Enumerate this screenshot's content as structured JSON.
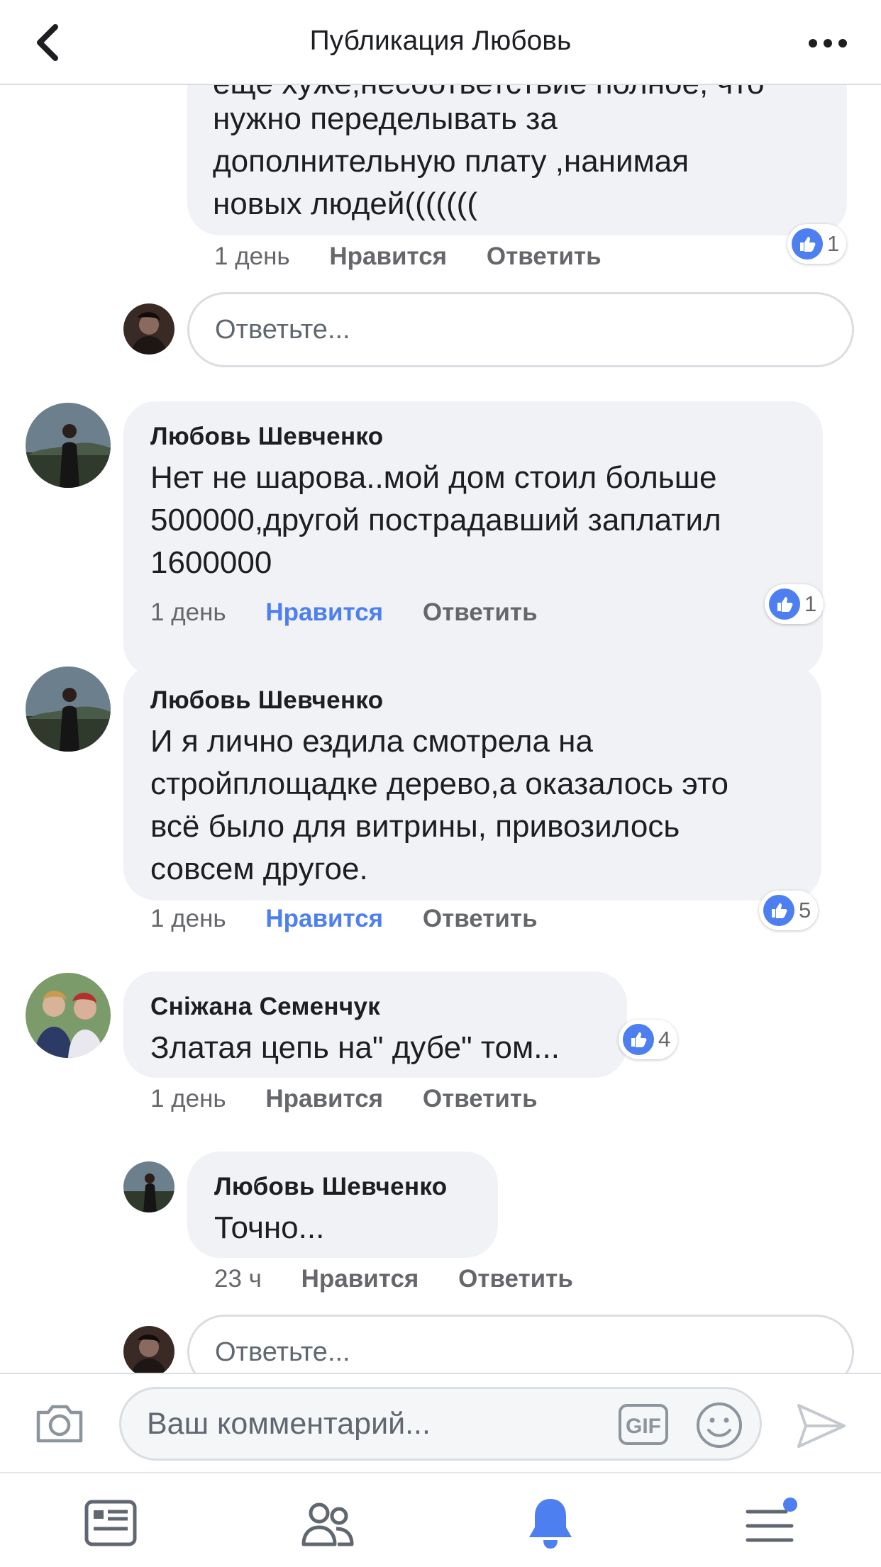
{
  "header": {
    "title": "Публикация Любовь"
  },
  "partial_comment": {
    "lines": [
      "ещё хуже,несоответствие полное, что",
      "нужно переделывать за",
      "дополнительную плату ,нанимая",
      "новых людей((((((("
    ],
    "time": "1 день",
    "like": "Нравится",
    "reply": "Ответить",
    "reactions": "1"
  },
  "reply_box_1": {
    "placeholder": "Ответьте..."
  },
  "comments": [
    {
      "author": "Любовь Шевченко",
      "lines": [
        "Нет не шарова..мой дом стоил больше",
        "500000,другой пострадавший заплатил",
        "1600000"
      ],
      "time": "1 день",
      "like": "Нравится",
      "reply": "Ответить",
      "reactions": "1"
    },
    {
      "author": "Любовь Шевченко",
      "lines": [
        "И я лично ездила смотрела на",
        "стройплощадке дерево,а оказалось это",
        "всё было для витрины, привозилось",
        "совсем другое."
      ],
      "time": "1 день",
      "like": "Нравится",
      "reply": "Ответить",
      "reactions": "5"
    },
    {
      "author": "Сніжана Семенчук",
      "lines": [
        "Златая цепь на\" дубе\" том..."
      ],
      "time": "1 день",
      "like": "Нравится",
      "reply": "Ответить",
      "reactions": "4"
    }
  ],
  "nested_reply": {
    "author": "Любовь Шевченко",
    "text": "Точно...",
    "time": "23 ч",
    "like": "Нравится",
    "reply": "Ответить"
  },
  "reply_box_2": {
    "placeholder": "Ответьте..."
  },
  "composer": {
    "placeholder": "Ваш комментарий...",
    "gif_label": "GIF"
  },
  "colors": {
    "accent": "#4d7ff0",
    "bubble": "#f0f2f5",
    "secondary_text": "#65676b"
  },
  "icons": [
    "back-arrow-icon",
    "more-dots-icon",
    "camera-icon",
    "gif-icon",
    "emoji-icon",
    "send-icon",
    "news-feed-icon",
    "friends-icon",
    "notifications-bell-icon",
    "menu-icon"
  ]
}
